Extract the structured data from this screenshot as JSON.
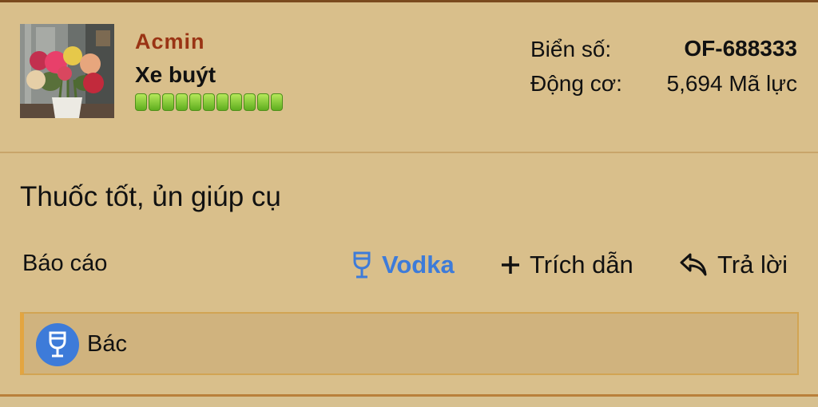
{
  "post": {
    "author": {
      "name": "Acmin",
      "title": "Xe buýt",
      "reputation_level": 11,
      "avatar_icon": "flower-bouquet-photo"
    },
    "info": {
      "plate_label": "Biển số:",
      "plate_value": "OF-688333",
      "engine_label": "Động cơ:",
      "engine_value": "5,694 Mã lực"
    },
    "message": "Thuốc tốt, ủn giúp cụ",
    "actions": {
      "report": "Báo cáo",
      "vodka": "Vodka",
      "quote": "Trích dẫn",
      "reply": "Trả lời"
    },
    "reaction": {
      "icon": "wine-glass-icon",
      "user": "Bác"
    }
  },
  "colors": {
    "background": "#d9bf8b",
    "username": "#9a3414",
    "accent_blue": "#3d7bd9",
    "reputation_green": "#5fae1e"
  }
}
